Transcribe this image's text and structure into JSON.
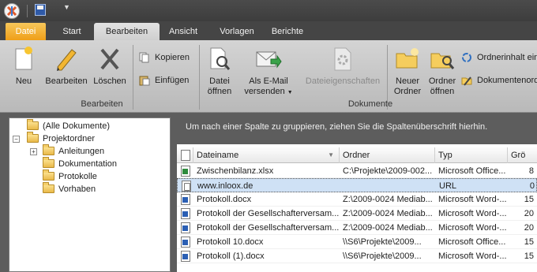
{
  "ribbon_tabs": {
    "datei": "Datei",
    "start": "Start",
    "bearbeiten": "Bearbeiten",
    "ansicht": "Ansicht",
    "vorlagen": "Vorlagen",
    "berichte": "Berichte"
  },
  "ribbon": {
    "neu": "Neu",
    "bearbeiten": "Bearbeiten",
    "loeschen": "Löschen",
    "kopieren": "Kopieren",
    "einfuegen": "Einfügen",
    "group_bearbeiten": "Bearbeiten",
    "datei_oeffnen_1": "Datei",
    "datei_oeffnen_2": "öffnen",
    "email_1": "Als E-Mail",
    "email_2": "versenden",
    "dateieigenschaften": "Dateieigenschaften",
    "neuer_ordner_1": "Neuer",
    "neuer_ordner_2": "Ordner",
    "ordner_oeffnen_1": "Ordner",
    "ordner_oeffnen_2": "öffnen",
    "ordnerinhalt": "Ordnerinhalt einl",
    "dokumentenordner": "Dokumentenordn",
    "group_dokumente": "Dokumente"
  },
  "tree": {
    "root_all": "(Alle Dokumente)",
    "projektordner": "Projektordner",
    "anleitungen": "Anleitungen",
    "dokumentation": "Dokumentation",
    "protokolle": "Protokolle",
    "vorhaben": "Vorhaben"
  },
  "grid": {
    "group_hint": "Um nach einer Spalte zu gruppieren, ziehen Sie die Spaltenüberschrift hierhin.",
    "columns": {
      "dateiname": "Dateiname",
      "ordner": "Ordner",
      "typ": "Typ",
      "groesse": "Grö"
    },
    "rows": [
      {
        "name": "Zwischenbilanz.xlsx",
        "ordner": "C:\\Projekte\\2009-002...",
        "typ": "Microsoft Office...",
        "size": "8",
        "icon": "excel"
      },
      {
        "name": "www.inloox.de",
        "ordner": "",
        "typ": "URL",
        "size": "0",
        "icon": "url"
      },
      {
        "name": "Protokoll.docx",
        "ordner": "Z:\\2009-0024 Mediab...",
        "typ": "Microsoft Word-...",
        "size": "15",
        "icon": "word"
      },
      {
        "name": "Protokoll der Gesellschafterversam...",
        "ordner": "Z:\\2009-0024 Mediab...",
        "typ": "Microsoft Word-...",
        "size": "20",
        "icon": "word"
      },
      {
        "name": "Protokoll der Gesellschafterversam...",
        "ordner": "Z:\\2009-0024 Mediab...",
        "typ": "Microsoft Word-...",
        "size": "20",
        "icon": "word"
      },
      {
        "name": "Protokoll 10.docx",
        "ordner": "\\\\S6\\Projekte\\2009...",
        "typ": "Microsoft Office...",
        "size": "15",
        "icon": "word"
      },
      {
        "name": "Protokoll (1).docx",
        "ordner": "\\\\S6\\Projekte\\2009...",
        "typ": "Microsoft Word-...",
        "size": "15",
        "icon": "word"
      }
    ]
  }
}
